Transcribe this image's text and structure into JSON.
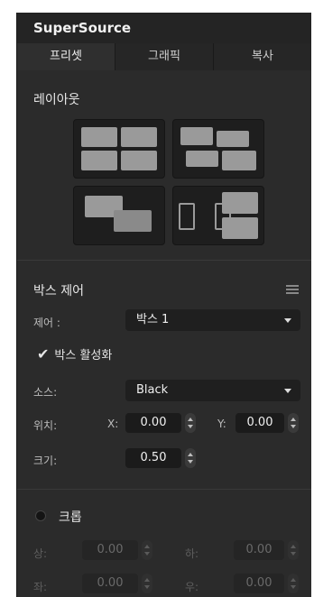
{
  "panel": {
    "title": "SuperSource",
    "tabs": [
      "프리셋",
      "그래픽",
      "복사"
    ]
  },
  "layout": {
    "title": "레이아웃"
  },
  "box_control": {
    "title": "박스 제어",
    "control_label": "제어 :",
    "control_value": "박스 1",
    "enable_label": "박스 활성화",
    "source_label": "소스:",
    "source_value": "Black",
    "position_label": "위치:",
    "x_label": "X:",
    "x_value": "0.00",
    "y_label": "Y:",
    "y_value": "0.00",
    "size_label": "크기:",
    "size_value": "0.50"
  },
  "crop": {
    "title": "크롭",
    "top_label": "상:",
    "top_value": "0.00",
    "bottom_label": "하:",
    "bottom_value": "0.00",
    "left_label": "좌:",
    "left_value": "0.00",
    "right_label": "우:",
    "right_value": "0.00"
  },
  "colors": {
    "panel_bg": "#2b2b2b",
    "field_bg": "#1f1f1f",
    "icon_gray": "#9a9a9a"
  }
}
